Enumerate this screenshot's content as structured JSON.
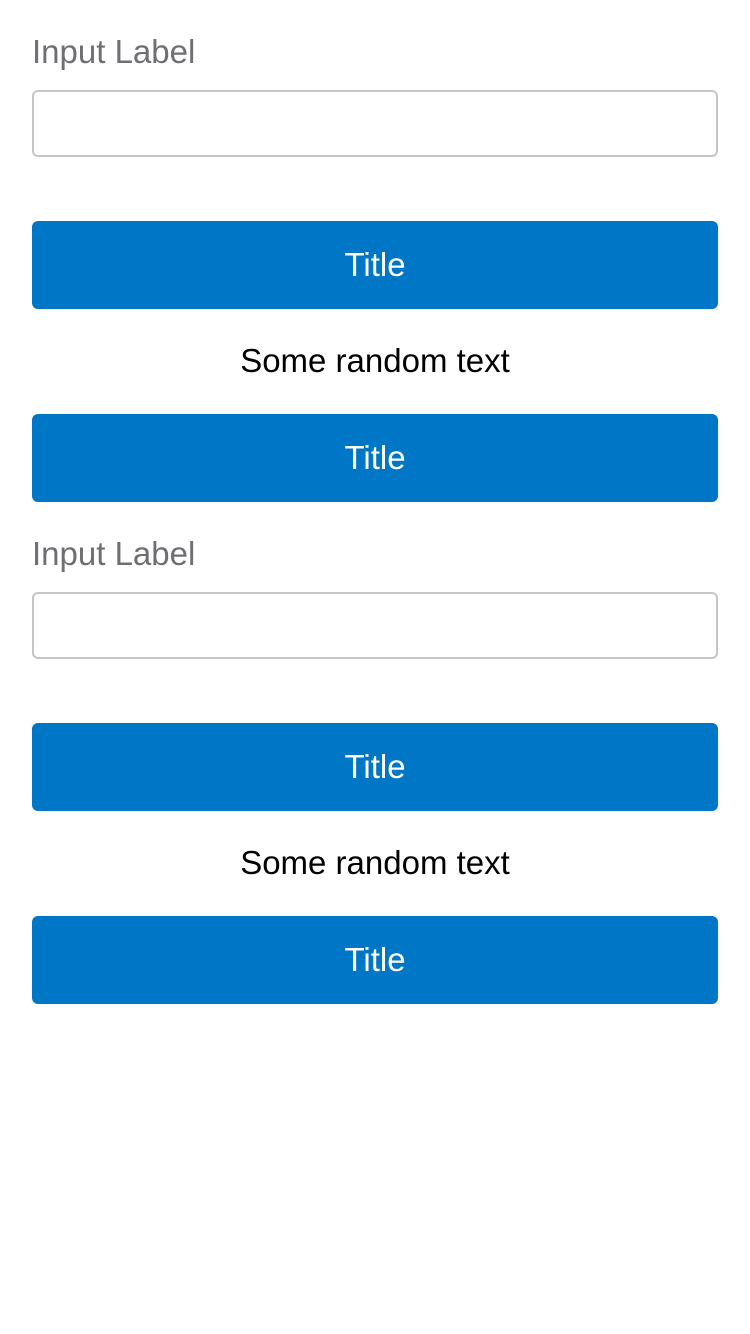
{
  "sections": [
    {
      "input_label": "Input Label",
      "input_value": "",
      "input_placeholder": "",
      "button_top_label": "Title",
      "text": "Some random text",
      "button_bottom_label": "Title"
    },
    {
      "input_label": "Input Label",
      "input_value": "",
      "input_placeholder": "",
      "button_top_label": "Title",
      "text": "Some random text",
      "button_bottom_label": "Title"
    }
  ],
  "colors": {
    "button_background": "#0076c6",
    "button_text": "#ffffff",
    "label_text": "#6f6f73",
    "input_border": "#c5c5c7",
    "body_text": "#000000"
  }
}
